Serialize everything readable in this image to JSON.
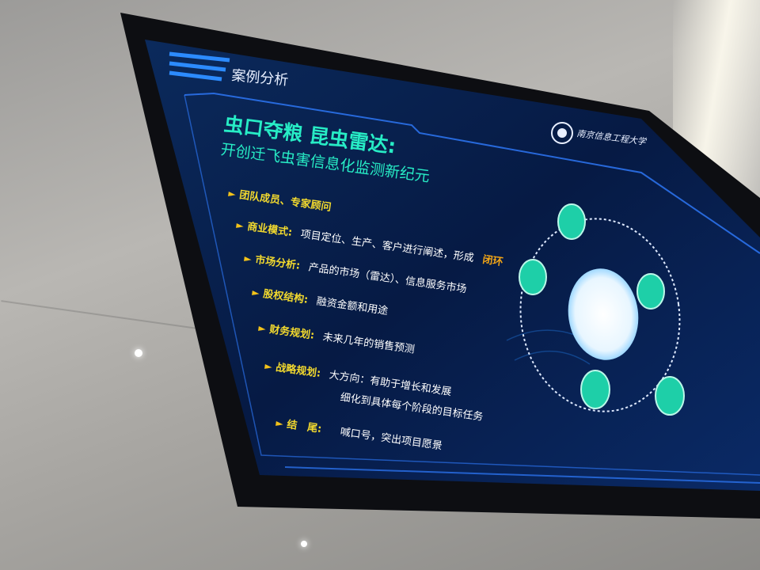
{
  "header": {
    "section_label": "案例分析"
  },
  "logo": {
    "text": "南京信息工程大学"
  },
  "title": {
    "line1": "虫口夺粮  昆虫雷达:",
    "line2": "开创迁飞虫害信息化监测新纪元"
  },
  "bullets": [
    {
      "label": "团队成员、专家顾问",
      "text": ""
    },
    {
      "label": "商业模式:",
      "text": "项目定位、生产、客户进行阐述，形成",
      "highlight": "闭环"
    },
    {
      "label": "市场分析:",
      "text": "产品的市场（雷达）、信息服务市场"
    },
    {
      "label": "股权结构:",
      "text": "融资金额和用途"
    },
    {
      "label": "财务规划:",
      "text": "未来几年的销售预测"
    },
    {
      "label": "战略规划:",
      "text": "大方向：有助于增长和发展",
      "text2": "细化到具体每个阶段的目标任务"
    },
    {
      "label": "结　尾:",
      "text": "喊口号，突出项目愿景"
    }
  ],
  "colors": {
    "screen_bg": "#071a3e",
    "accent": "#19e3c7",
    "text": "#ffffff",
    "highlight": "#f2a516"
  }
}
